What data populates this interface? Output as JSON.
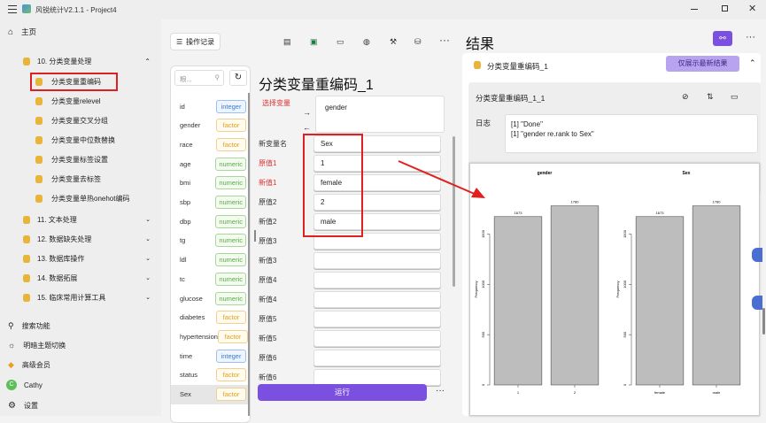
{
  "app": {
    "title": "风锐统计V2.1.1 - Project4"
  },
  "sidebar": {
    "home": "主页",
    "section": "10. 分类变量处理",
    "items": [
      "分类变量重编码",
      "分类变量relevel",
      "分类变量交叉分组",
      "分类变量中位数替换",
      "分类变量标签设置",
      "分类变量去标签",
      "分类变量单热onehot编码"
    ],
    "groups": [
      "11. 文本处理",
      "12. 数据缺失处理",
      "13. 数据库操作",
      "14. 数据拓展",
      "15. 临床常用计算工具"
    ],
    "bottom": [
      "搜索功能",
      "明暗主题切换",
      "高级会员",
      "Cathy",
      "设置"
    ],
    "avatar": "C"
  },
  "toolbar": {
    "log_button": "操作记录"
  },
  "varlist": {
    "search_placeholder": "粮...",
    "vars": [
      {
        "name": "id",
        "type": "integer"
      },
      {
        "name": "gender",
        "type": "factor"
      },
      {
        "name": "race",
        "type": "factor"
      },
      {
        "name": "age",
        "type": "numeric"
      },
      {
        "name": "bmi",
        "type": "numeric"
      },
      {
        "name": "sbp",
        "type": "numeric"
      },
      {
        "name": "dbp",
        "type": "numeric"
      },
      {
        "name": "tg",
        "type": "numeric"
      },
      {
        "name": "ldl",
        "type": "numeric"
      },
      {
        "name": "tc",
        "type": "numeric"
      },
      {
        "name": "glucose",
        "type": "numeric"
      },
      {
        "name": "diabetes",
        "type": "factor"
      },
      {
        "name": "hypertension",
        "type": "factor"
      },
      {
        "name": "time",
        "type": "integer"
      },
      {
        "name": "status",
        "type": "factor"
      },
      {
        "name": "Sex",
        "type": "factor"
      }
    ]
  },
  "form": {
    "title": "分类变量重编码_1",
    "select_label": "选择变量",
    "selected_var": "gender",
    "fields": [
      {
        "label": "新变量名",
        "value": "Sex",
        "red": false
      },
      {
        "label": "原值1",
        "value": "1",
        "red": true
      },
      {
        "label": "新值1",
        "value": "female",
        "red": true
      },
      {
        "label": "原值2",
        "value": "2",
        "red": false
      },
      {
        "label": "新值2",
        "value": "male",
        "red": false
      },
      {
        "label": "原值3",
        "value": "",
        "red": false
      },
      {
        "label": "新值3",
        "value": "",
        "red": false
      },
      {
        "label": "原值4",
        "value": "",
        "red": false
      },
      {
        "label": "新值4",
        "value": "",
        "red": false
      },
      {
        "label": "原值5",
        "value": "",
        "red": false
      },
      {
        "label": "新值5",
        "value": "",
        "red": false
      },
      {
        "label": "原值6",
        "value": "",
        "red": false
      },
      {
        "label": "新值6",
        "value": "",
        "red": false
      }
    ],
    "run_button": "运行",
    "more": "···"
  },
  "results": {
    "title": "结果",
    "more": "···",
    "item_title": "分类变量重编码_1",
    "latest_button": "仅展示最新结果",
    "sub_title": "分类变量重编码_1_1",
    "log_label": "日志",
    "log_lines": [
      "[1] \"Done\"",
      "[1] \"gender re.rank to Sex\""
    ]
  },
  "chart_data": [
    {
      "type": "bar",
      "title": "gender",
      "categories": [
        "1",
        "2"
      ],
      "values": [
        1673,
        1780
      ],
      "ylabel": "Frequency",
      "yticks": [
        0,
        500,
        1000,
        1500
      ],
      "ylim": [
        0,
        1900
      ],
      "bar_color": "#bdbdbd"
    },
    {
      "type": "bar",
      "title": "Sex",
      "categories": [
        "female",
        "male"
      ],
      "values": [
        1673,
        1780
      ],
      "ylabel": "Frequency",
      "yticks": [
        0,
        500,
        1000,
        1500
      ],
      "ylim": [
        0,
        1900
      ],
      "bar_color": "#bdbdbd"
    }
  ],
  "colors": {
    "accent": "#7b4fe0",
    "highlight": "#e02020",
    "badge_integer": "#3a7bd5",
    "badge_factor": "#e0a020",
    "badge_numeric": "#5aa84a"
  }
}
